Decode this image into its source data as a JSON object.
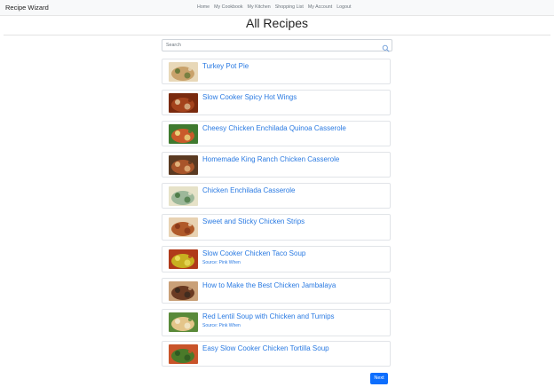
{
  "navbar": {
    "brand": "Recipe Wizard",
    "links": [
      "Home",
      "My Cookbook",
      "My Kitchen",
      "Shopping List",
      "My Account",
      "Logout"
    ]
  },
  "page": {
    "title": "All Recipes"
  },
  "search": {
    "placeholder": "Search",
    "icon": "search-icon"
  },
  "recipes": [
    {
      "title": "Turkey Pot Pie",
      "source": "",
      "image_colors": [
        "#c9a26b",
        "#e8d8b8",
        "#6b7a3a"
      ]
    },
    {
      "title": "Slow Cooker Spicy Hot Wings",
      "source": "",
      "image_colors": [
        "#a4431c",
        "#7a2a0e",
        "#d9b48a"
      ]
    },
    {
      "title": "Cheesy Chicken Enchilada Quinoa Casserole",
      "source": "",
      "image_colors": [
        "#c95a2a",
        "#3f7a2f",
        "#e9d27a"
      ]
    },
    {
      "title": "Homemade King Ranch Chicken Casserole",
      "source": "",
      "image_colors": [
        "#a8552a",
        "#5a3a22",
        "#e2b27a"
      ]
    },
    {
      "title": "Chicken Enchilada Casserole",
      "source": "",
      "image_colors": [
        "#9db89a",
        "#e6e2c8",
        "#4f7d4a"
      ]
    },
    {
      "title": "Sweet and Sticky Chicken Strips",
      "source": "",
      "image_colors": [
        "#b05a2a",
        "#e8d2b2",
        "#8a3a1a"
      ]
    },
    {
      "title": "Slow Cooker Chicken Taco Soup",
      "source": "Source: Pink When",
      "image_colors": [
        "#c8b020",
        "#b03a1a",
        "#e8dc5a"
      ]
    },
    {
      "title": "How to Make the Best Chicken Jambalaya",
      "source": "",
      "image_colors": [
        "#6a3a22",
        "#c9a078",
        "#3a2a1e"
      ]
    },
    {
      "title": "Red Lentil Soup with Chicken and Turnips",
      "source": "Source: Pink When",
      "image_colors": [
        "#e4c58a",
        "#5a8a3a",
        "#f2e6c8"
      ]
    },
    {
      "title": "Easy Slow Cooker Chicken Tortilla Soup",
      "source": "",
      "image_colors": [
        "#4a7a2a",
        "#c9542a",
        "#2f5a22"
      ]
    }
  ],
  "pagination": {
    "next_label": "Next"
  },
  "colors": {
    "link": "#2a7ae2",
    "primary_button": "#0d6efd",
    "navbar_bg": "#f8f9fa"
  }
}
